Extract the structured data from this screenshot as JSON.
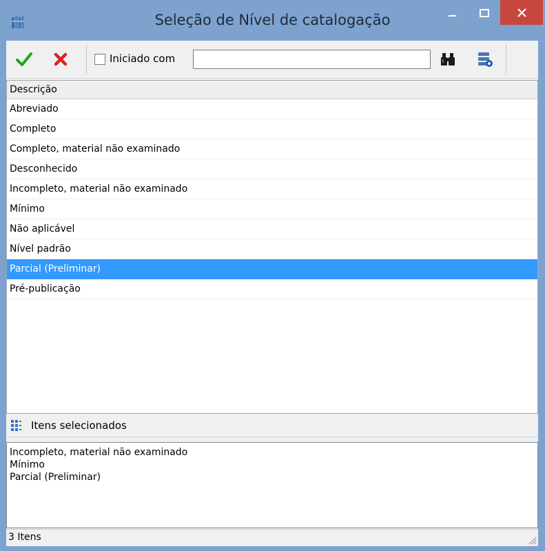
{
  "window": {
    "title": "Seleção de Nível de catalogação",
    "accent_color": "#7da2ce",
    "close_color": "#c7463d",
    "controls": [
      "minimize-icon",
      "maximize-icon",
      "close-icon"
    ]
  },
  "toolbar": {
    "confirm_icon": "check-icon",
    "cancel_icon": "x-icon",
    "checkbox_label": "Iniciado com",
    "checkbox_checked": false,
    "search_value": "",
    "find_icon": "binoculars-icon",
    "options_icon": "database-settings-icon"
  },
  "grid": {
    "column_header": "Descrição",
    "rows": [
      "Abreviado",
      "Completo",
      "Completo, material não examinado",
      "Desconhecido",
      "Incompleto, material não examinado",
      "Mínimo",
      "Não aplicável",
      "Nível padrão",
      "Parcial (Preliminar)",
      "Pré-publicação"
    ],
    "selected_row": "Parcial (Preliminar)",
    "selection_color": "#3399ff"
  },
  "selected_section": {
    "title": "Itens selecionados",
    "items": [
      "Incompleto, material não examinado",
      "Mínimo",
      "Parcial (Preliminar)"
    ]
  },
  "status": {
    "count_text": "3 Itens"
  }
}
